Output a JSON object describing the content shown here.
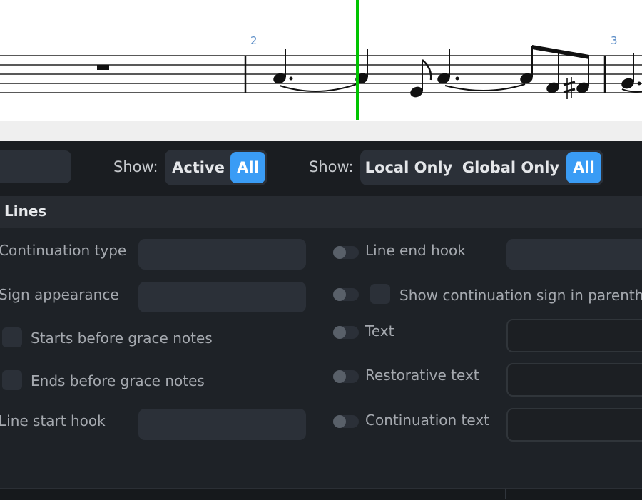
{
  "score": {
    "measure_numbers": [
      "2",
      "3"
    ],
    "playhead_color": "#00cc00"
  },
  "filter_bar": {
    "show_label_1": "Show:",
    "state_filter": [
      "Active",
      "All"
    ],
    "state_selected": "All",
    "show_label_2": "Show:",
    "scope_filter": [
      "Local Only",
      "Global Only",
      "All"
    ],
    "scope_selected": "All",
    "accent_color": "#3a9cf5"
  },
  "section": {
    "title": "Lines",
    "left": {
      "continuation_type": "Continuation type",
      "sign_appearance": "Sign appearance",
      "starts_before_grace": "Starts before grace notes",
      "ends_before_grace": "Ends before grace notes",
      "line_start_hook": "Line start hook"
    },
    "right": {
      "line_end_hook": "Line end hook",
      "show_continuation_sign": "Show continuation sign in parenthe",
      "text": "Text",
      "restorative_text": "Restorative text",
      "continuation_text": "Continuation text"
    }
  }
}
